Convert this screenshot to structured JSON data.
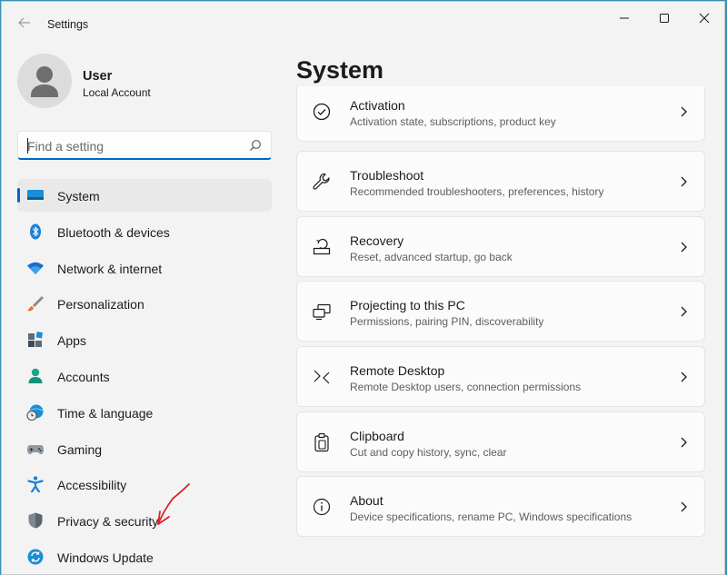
{
  "window": {
    "title": "Settings"
  },
  "user": {
    "name": "User",
    "account_type": "Local Account"
  },
  "search": {
    "placeholder": "Find a setting",
    "value": ""
  },
  "nav": {
    "items": [
      {
        "label": "System",
        "icon": "system-icon",
        "active": true
      },
      {
        "label": "Bluetooth & devices",
        "icon": "bluetooth-icon"
      },
      {
        "label": "Network & internet",
        "icon": "wifi-icon"
      },
      {
        "label": "Personalization",
        "icon": "brush-icon"
      },
      {
        "label": "Apps",
        "icon": "apps-icon"
      },
      {
        "label": "Accounts",
        "icon": "accounts-icon"
      },
      {
        "label": "Time & language",
        "icon": "globe-clock-icon"
      },
      {
        "label": "Gaming",
        "icon": "gamepad-icon"
      },
      {
        "label": "Accessibility",
        "icon": "accessibility-icon"
      },
      {
        "label": "Privacy & security",
        "icon": "shield-icon"
      },
      {
        "label": "Windows Update",
        "icon": "update-icon"
      }
    ]
  },
  "main": {
    "title": "System",
    "cards": [
      {
        "title": "Activation",
        "description": "Activation state, subscriptions, product key",
        "icon": "check-circle-icon"
      },
      {
        "title": "Troubleshoot",
        "description": "Recommended troubleshooters, preferences, history",
        "icon": "wrench-icon"
      },
      {
        "title": "Recovery",
        "description": "Reset, advanced startup, go back",
        "icon": "recovery-icon"
      },
      {
        "title": "Projecting to this PC",
        "description": "Permissions, pairing PIN, discoverability",
        "icon": "projection-icon"
      },
      {
        "title": "Remote Desktop",
        "description": "Remote Desktop users, connection permissions",
        "icon": "remote-desktop-icon"
      },
      {
        "title": "Clipboard",
        "description": "Cut and copy history, sync, clear",
        "icon": "clipboard-icon"
      },
      {
        "title": "About",
        "description": "Device specifications, rename PC, Windows specifications",
        "icon": "info-icon"
      }
    ]
  },
  "colors": {
    "accent": "#0067c0",
    "annotation": "#d8232a"
  }
}
